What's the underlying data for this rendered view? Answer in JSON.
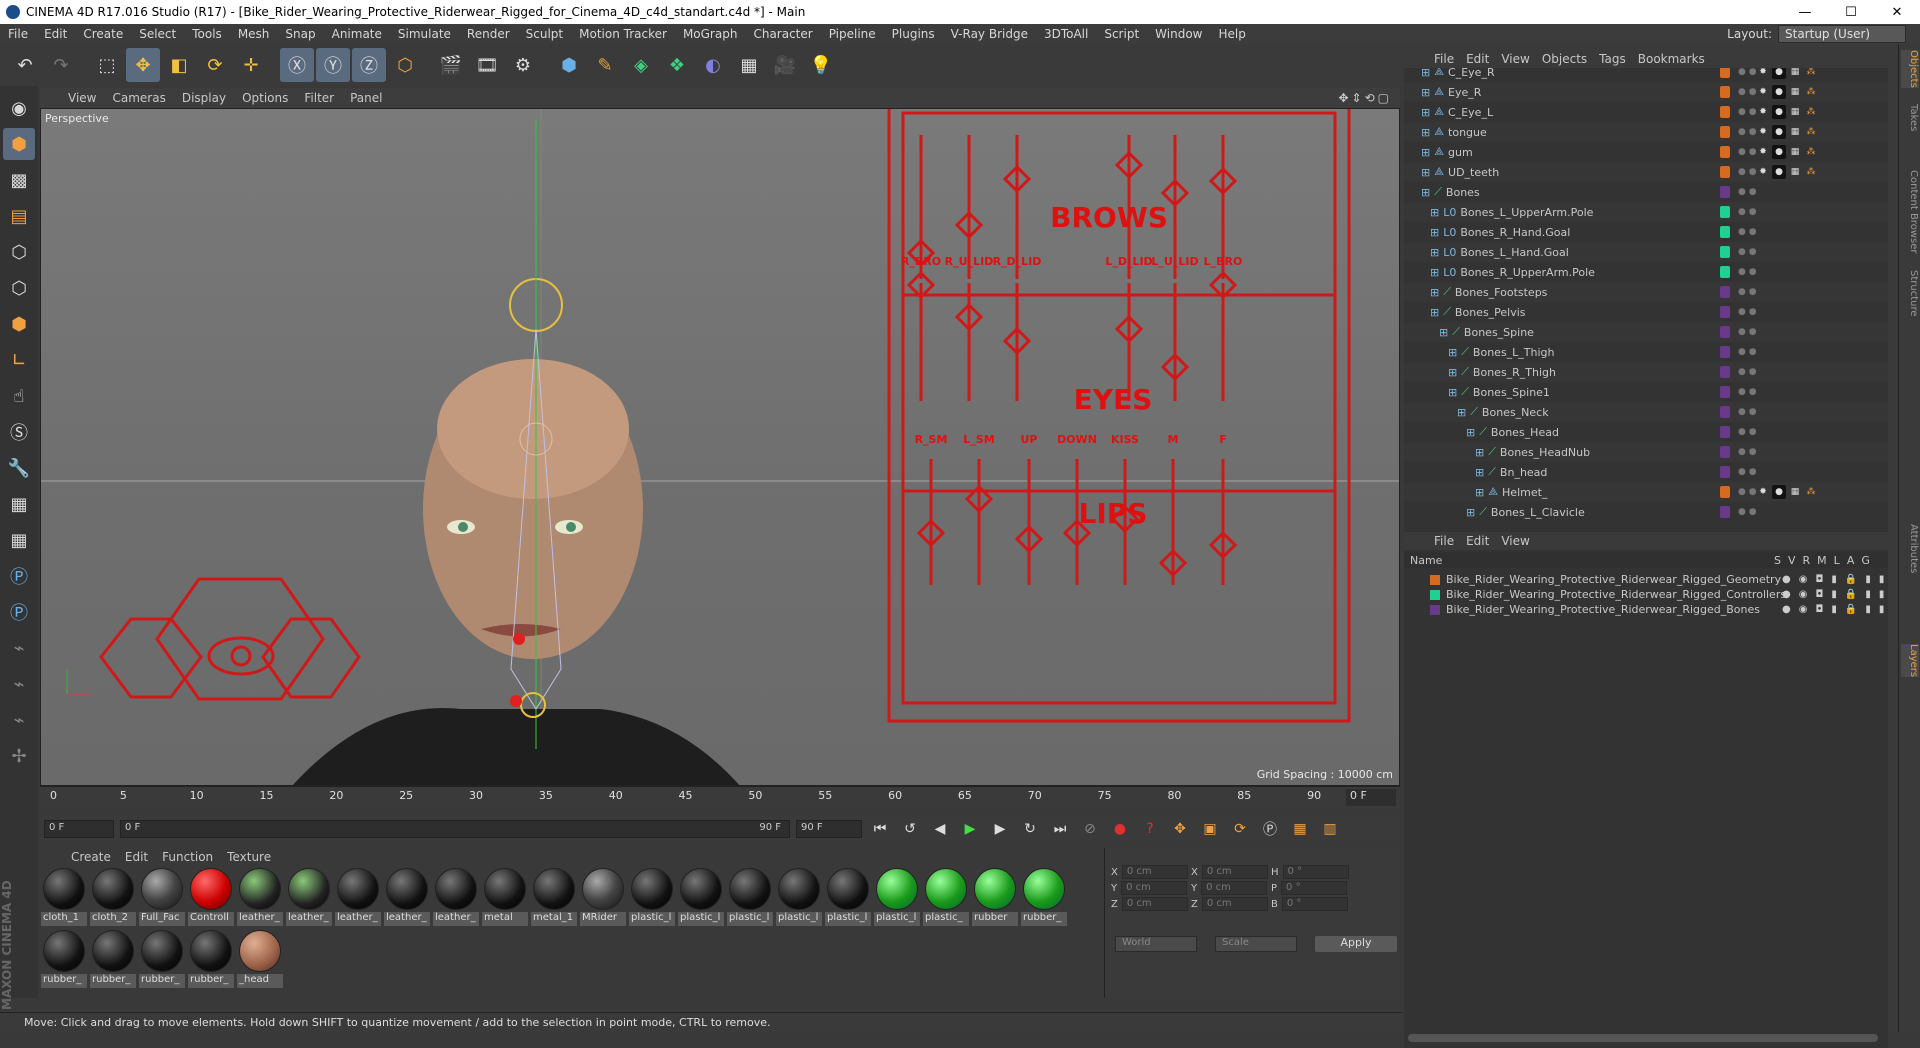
{
  "window": {
    "title": "CINEMA 4D R17.016 Studio (R17) - [Bike_Rider_Wearing_Protective_Riderwear_Rigged_for_Cinema_4D_c4d_standart.c4d *] - Main",
    "minimize": "—",
    "maximize": "☐",
    "close": "✕"
  },
  "menubar": {
    "items": [
      "File",
      "Edit",
      "Create",
      "Select",
      "Tools",
      "Mesh",
      "Snap",
      "Animate",
      "Simulate",
      "Render",
      "Sculpt",
      "Motion Tracker",
      "MoGraph",
      "Character",
      "Pipeline",
      "Plugins",
      "V-Ray Bridge",
      "3DToAll",
      "Script",
      "Window",
      "Help"
    ],
    "layout_label": "Layout:",
    "layout_value": "Startup (User)"
  },
  "viewport": {
    "menu": [
      "View",
      "Cameras",
      "Display",
      "Options",
      "Filter",
      "Panel"
    ],
    "nav_icons": "✥⇕⟲▢",
    "label": "Perspective",
    "grid_spacing": "Grid Spacing : 10000 cm",
    "facial_rig": {
      "brows": "BROWS",
      "eyes": "EYES",
      "lips": "LIPS",
      "eye_labels": [
        "R_BRO",
        "R_U_LID",
        "R_D_LID",
        "L_D_LID",
        "L_U_LID",
        "L_BRO"
      ],
      "lip_labels": [
        "R_SM",
        "L_SM",
        "UP",
        "DOWN",
        "KISS",
        "M",
        "F"
      ]
    }
  },
  "timeline": {
    "ticks": [
      "0",
      "5",
      "10",
      "15",
      "20",
      "25",
      "30",
      "35",
      "40",
      "45",
      "50",
      "55",
      "60",
      "65",
      "70",
      "75",
      "80",
      "85",
      "90"
    ],
    "current_frame": "0 F"
  },
  "playbar": {
    "start": "0 F",
    "range_start": "0 F",
    "range_end": "90 F",
    "end": "90 F"
  },
  "materials": {
    "menu": [
      "Create",
      "Edit",
      "Function",
      "Texture"
    ],
    "items": [
      {
        "label": "cloth_1",
        "kind": "dark"
      },
      {
        "label": "cloth_2",
        "kind": "dark"
      },
      {
        "label": "Full_Fac",
        "kind": "tex"
      },
      {
        "label": "Controll",
        "kind": "red"
      },
      {
        "label": "leather_",
        "kind": "greenish"
      },
      {
        "label": "leather_",
        "kind": "greenish"
      },
      {
        "label": "leather_",
        "kind": "dark"
      },
      {
        "label": "leather_",
        "kind": "dark"
      },
      {
        "label": "leather_",
        "kind": "dark"
      },
      {
        "label": "metal",
        "kind": "dark"
      },
      {
        "label": "metal_1",
        "kind": "dark"
      },
      {
        "label": "MRider",
        "kind": "tex"
      },
      {
        "label": "plastic_l",
        "kind": "dark"
      },
      {
        "label": "plastic_l",
        "kind": "dark"
      },
      {
        "label": "plastic_l",
        "kind": "dark"
      },
      {
        "label": "plastic_l",
        "kind": "dark"
      },
      {
        "label": "plastic_l",
        "kind": "dark"
      },
      {
        "label": "plastic_l",
        "kind": "green"
      },
      {
        "label": "plastic_",
        "kind": "green"
      },
      {
        "label": "rubber",
        "kind": "green"
      },
      {
        "label": "rubber_",
        "kind": "green"
      },
      {
        "label": "rubber_",
        "kind": "dark"
      },
      {
        "label": "rubber_",
        "kind": "dark"
      },
      {
        "label": "rubber_",
        "kind": "dark"
      },
      {
        "label": "rubber_",
        "kind": "dark"
      },
      {
        "label": "_head",
        "kind": "skin"
      }
    ]
  },
  "coords": {
    "pos": [
      {
        "axis": "X",
        "val": "0 cm"
      },
      {
        "axis": "Y",
        "val": "0 cm"
      },
      {
        "axis": "Z",
        "val": "0 cm"
      }
    ],
    "size": [
      {
        "axis": "X",
        "val": "0 cm"
      },
      {
        "axis": "Y",
        "val": "0 cm"
      },
      {
        "axis": "Z",
        "val": "0 cm"
      }
    ],
    "rot": [
      {
        "axis": "H",
        "val": "0 °"
      },
      {
        "axis": "P",
        "val": "0 °"
      },
      {
        "axis": "B",
        "val": "0 °"
      }
    ],
    "world": "World",
    "scale": "Scale",
    "apply": "Apply"
  },
  "status": "Move: Click and drag to move elements. Hold down SHIFT to quantize movement / add to the selection in point mode, CTRL to remove.",
  "objects": {
    "menu": [
      "File",
      "Edit",
      "View",
      "Objects",
      "Tags",
      "Bookmarks"
    ],
    "rows": [
      {
        "name": "C_Eye_R",
        "indent": 1,
        "type": "null",
        "color": "#d66a20"
      },
      {
        "name": "Eye_R",
        "indent": 1,
        "type": "null",
        "color": "#d66a20"
      },
      {
        "name": "C_Eye_L",
        "indent": 1,
        "type": "null",
        "color": "#d66a20"
      },
      {
        "name": "tongue",
        "indent": 1,
        "type": "null",
        "color": "#d66a20"
      },
      {
        "name": "gum",
        "indent": 1,
        "type": "null",
        "color": "#d66a20"
      },
      {
        "name": "UD_teeth",
        "indent": 1,
        "type": "null",
        "color": "#d66a20"
      },
      {
        "name": "Bones",
        "indent": 1,
        "type": "bone",
        "color": "#6a3a8a"
      },
      {
        "name": "Bones_L_UpperArm.Pole",
        "indent": 2,
        "type": "null2",
        "color": "#20d090"
      },
      {
        "name": "Bones_R_Hand.Goal",
        "indent": 2,
        "type": "null2",
        "color": "#20d090"
      },
      {
        "name": "Bones_L_Hand.Goal",
        "indent": 2,
        "type": "null2",
        "color": "#20d090"
      },
      {
        "name": "Bones_R_UpperArm.Pole",
        "indent": 2,
        "type": "null2",
        "color": "#20d090"
      },
      {
        "name": "Bones_Footsteps",
        "indent": 2,
        "type": "bone",
        "color": "#6a3a8a"
      },
      {
        "name": "Bones_Pelvis",
        "indent": 2,
        "type": "bone",
        "color": "#6a3a8a"
      },
      {
        "name": "Bones_Spine",
        "indent": 3,
        "type": "bone",
        "color": "#6a3a8a"
      },
      {
        "name": "Bones_L_Thigh",
        "indent": 4,
        "type": "bone",
        "color": "#6a3a8a"
      },
      {
        "name": "Bones_R_Thigh",
        "indent": 4,
        "type": "bone",
        "color": "#6a3a8a"
      },
      {
        "name": "Bones_Spine1",
        "indent": 4,
        "type": "bone",
        "color": "#6a3a8a"
      },
      {
        "name": "Bones_Neck",
        "indent": 5,
        "type": "bone",
        "color": "#6a3a8a"
      },
      {
        "name": "Bones_Head",
        "indent": 6,
        "type": "bone",
        "color": "#6a3a8a"
      },
      {
        "name": "Bones_HeadNub",
        "indent": 7,
        "type": "bone",
        "color": "#6a3a8a"
      },
      {
        "name": "Bn_head",
        "indent": 7,
        "type": "bone",
        "color": "#6a3a8a"
      },
      {
        "name": "Helmet_",
        "indent": 7,
        "type": "null",
        "color": "#d66a20"
      },
      {
        "name": "Bones_L_Clavicle",
        "indent": 6,
        "type": "bone",
        "color": "#6a3a8a"
      }
    ]
  },
  "layers": {
    "menu": [
      "File",
      "Edit",
      "View"
    ],
    "header": {
      "name": "Name",
      "cols": [
        "S",
        "V",
        "R",
        "M",
        "L",
        "A",
        "G"
      ]
    },
    "rows": [
      {
        "name": "Bike_Rider_Wearing_Protective_Riderwear_Rigged_Geometry",
        "color": "#d66a20"
      },
      {
        "name": "Bike_Rider_Wearing_Protective_Riderwear_Rigged_Controllers",
        "color": "#20d090"
      },
      {
        "name": "Bike_Rider_Wearing_Protective_Riderwear_Rigged_Bones",
        "color": "#6a3a8a"
      }
    ]
  },
  "side_tabs": [
    "Objects",
    "Takes",
    "Content Browser",
    "Structure",
    "Attributes",
    "Layers"
  ]
}
